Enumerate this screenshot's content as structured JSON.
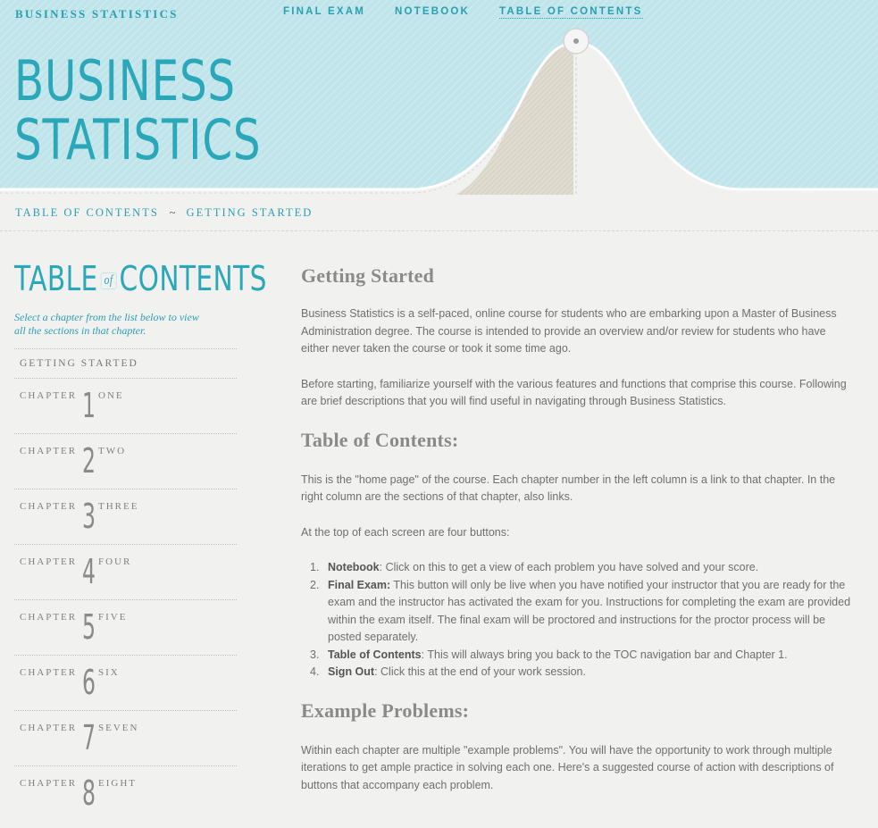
{
  "brand": "BUSINESS STATISTICS",
  "nav": {
    "final_exam": "FINAL EXAM",
    "notebook": "NOTEBOOK",
    "toc": "TABLE OF CONTENTS"
  },
  "hero": {
    "line1": "BUSINESS",
    "line2": "STATISTICS"
  },
  "breadcrumb": {
    "item1": "TABLE OF CONTENTS",
    "separator": "~",
    "item2": "GETTING STARTED"
  },
  "sidebar": {
    "title_left": "TABLE",
    "title_of": "of",
    "title_right": "CONTENTS",
    "hint": "Select a chapter from the list below to view all the sections in that chapter.",
    "getting_started": "GETTING STARTED",
    "chapter_label": "CHAPTER",
    "chapters": [
      {
        "num": "1",
        "word": "ONE"
      },
      {
        "num": "2",
        "word": "TWO"
      },
      {
        "num": "3",
        "word": "THREE"
      },
      {
        "num": "4",
        "word": "FOUR"
      },
      {
        "num": "5",
        "word": "FIVE"
      },
      {
        "num": "6",
        "word": "SIX"
      },
      {
        "num": "7",
        "word": "SEVEN"
      },
      {
        "num": "8",
        "word": "EIGHT"
      }
    ]
  },
  "main": {
    "h_getting_started": "Getting Started",
    "p1": "Business Statistics is a self-paced, online course for students who are embarking upon a Master of Business Administration degree. The course is intended to provide an overview and/or review for students who have either never taken the course or took it some time ago.",
    "p2": "Before starting, familiarize yourself with the various features and functions that comprise this course. Following are brief descriptions that you will find useful in navigating through Business Statistics.",
    "h_toc": "Table of Contents:",
    "p3": "This is the \"home page\" of the course. Each chapter number in the left column is a link to that chapter. In the right column are the sections of that chapter, also links.",
    "p4": "At the top of each screen are four buttons:",
    "list": [
      {
        "n": "1.",
        "term": "Notebook",
        "text": ": Click on this to get a view of each problem you have solved and your score."
      },
      {
        "n": "2.",
        "term": "Final Exam:",
        "text": " This button will only be live when you have notified your instructor that you are ready for the exam and the instructor has activated the exam for you. Instructions for completing the exam are provided within the exam itself. The final exam will be proctored and instructions for the proctor process will be posted separately."
      },
      {
        "n": "3.",
        "term": "Table of Contents",
        "text": ": This will always bring you back to the TOC navigation bar and Chapter 1."
      },
      {
        "n": "4.",
        "term": "Sign Out",
        "text": ": Click this at the end of your work session."
      }
    ],
    "h_examples": "Example Problems:",
    "p5": "Within each chapter are multiple \"example problems\". You will have the opportunity to work through multiple iterations to get ample practice in solving each one. Here's a suggested course of action with descriptions of buttons that accompany each problem."
  },
  "colors": {
    "accent": "#2aa7b8",
    "header_bg": "#bfe4ea",
    "page_bg": "#f1f1f0",
    "text": "#6f6f6f"
  }
}
